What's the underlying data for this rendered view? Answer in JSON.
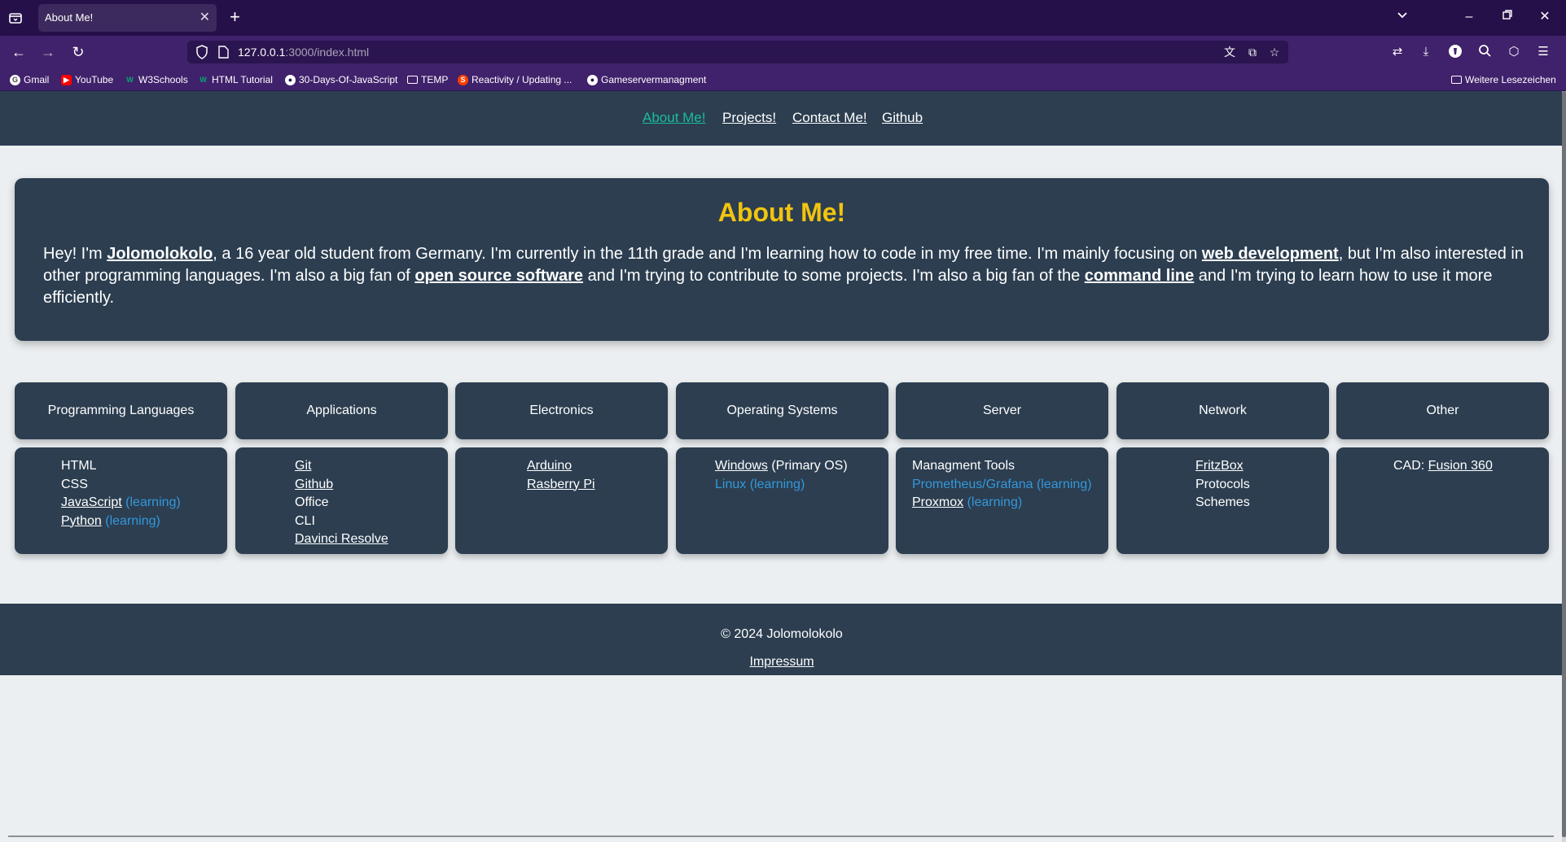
{
  "browser": {
    "tab_title": "About Me!",
    "url_host": "127.0.0.1",
    "url_path": ":3000/index.html",
    "bookmarks": [
      {
        "label": "Gmail",
        "icon": "google-icon",
        "color": "#ffffff"
      },
      {
        "label": "YouTube",
        "icon": "youtube-icon",
        "color": "#ff0000"
      },
      {
        "label": "W3Schools",
        "icon": "w3schools-icon",
        "color": "#04aa6d"
      },
      {
        "label": "HTML Tutorial",
        "icon": "w3schools-icon",
        "color": "#04aa6d"
      },
      {
        "label": "30-Days-Of-JavaScript",
        "icon": "github-icon",
        "color": "#ffffff"
      },
      {
        "label": "TEMP",
        "icon": "folder-icon",
        "color": "#ffffff"
      },
      {
        "label": "Reactivity / Updating ...",
        "icon": "svelte-icon",
        "color": "#ff3e00"
      },
      {
        "label": "Gameservermanagment",
        "icon": "github-icon",
        "color": "#ffffff"
      }
    ],
    "other_bookmarks": "Weitere Lesezeichen"
  },
  "site_nav": {
    "about": "About Me!",
    "projects": "Projects!",
    "contact": "Contact Me!",
    "github": "Github"
  },
  "about": {
    "title": "About Me!",
    "t1": "Hey! I'm ",
    "name": "Jolomolokolo",
    "t2": ", a 16 year old student from Germany. I'm currently in the 11th grade and I'm learning how to code in my free time. I'm mainly focusing on ",
    "webdev": "web development",
    "t3": ", but I'm also interested in other programming languages. I'm also a big fan of ",
    "oss": "open source software",
    "t4": " and I'm trying to contribute to some projects. I'm also a big fan of the ",
    "cli": "command line",
    "t5": " and I'm trying to learn how to use it more efficiently."
  },
  "categories": {
    "programming": {
      "title": "Programming Languages",
      "html": "HTML",
      "css": "CSS",
      "js": "JavaScript",
      "js_note": "(learning)",
      "python": "Python",
      "python_note": "(learning)"
    },
    "applications": {
      "title": "Applications",
      "git": "Git",
      "github": "Github",
      "office": "Office",
      "cli": "CLI",
      "davinci": "Davinci Resolve"
    },
    "electronics": {
      "title": "Electronics",
      "arduino": "Arduino",
      "pi": "Rasberry Pi"
    },
    "os": {
      "title": "Operating Systems",
      "windows": "Windows",
      "windows_note": " (Primary OS)",
      "linux": "Linux (learning)"
    },
    "server": {
      "title": "Server",
      "tools": "Managment Tools",
      "prometheus": "Prometheus/Grafana (learning)",
      "proxmox": "Proxmox",
      "proxmox_note": "(learning)"
    },
    "network": {
      "title": "Network",
      "fritzbox": "FritzBox",
      "protocols": "Protocols",
      "schemes": "Schemes"
    },
    "other": {
      "title": "Other",
      "cad_label": "CAD: ",
      "fusion": "Fusion 360"
    }
  },
  "footer": {
    "copyright": "© 2024 Jolomolokolo",
    "impressum": "Impressum"
  },
  "colors": {
    "panel": "#2c3e50",
    "accent_title": "#f1c40f",
    "active_nav": "#1abc9c",
    "learning": "#3498db"
  }
}
